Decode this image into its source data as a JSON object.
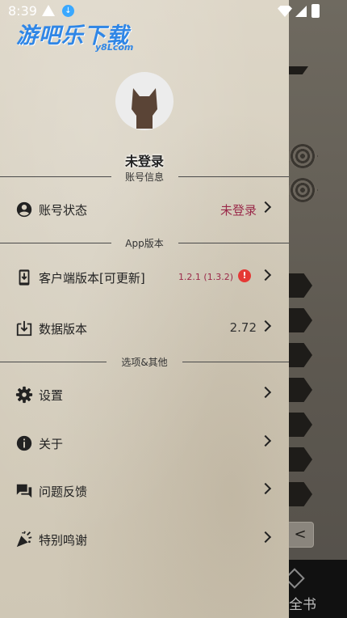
{
  "status_bar": {
    "time": "8:39"
  },
  "watermark": {
    "main": "游吧乐下载",
    "sub": "y8Lcom"
  },
  "background": {
    "bottom_label": "全书",
    "back_symbol": "<"
  },
  "drawer": {
    "username": "未登录",
    "sections": {
      "account": "账号信息",
      "app": "App版本",
      "other": "选项&其他"
    },
    "items": {
      "account_status": {
        "label": "账号状态",
        "value": "未登录",
        "icon": "account-circle-icon"
      },
      "client_version": {
        "label": "客户端版本[可更新]",
        "value": "1.2.1 (1.3.2)",
        "alert": "!",
        "icon": "phone-download-icon"
      },
      "data_version": {
        "label": "数据版本",
        "value": "2.72",
        "icon": "download-box-icon"
      },
      "settings": {
        "label": "设置",
        "icon": "gear-icon"
      },
      "about": {
        "label": "关于",
        "icon": "info-icon"
      },
      "feedback": {
        "label": "问题反馈",
        "icon": "chat-bubbles-icon"
      },
      "thanks": {
        "label": "特别鸣谢",
        "icon": "party-popper-icon"
      }
    }
  },
  "colors": {
    "accent_red": "#9a2a4a",
    "alert": "#e53935",
    "watermark_blue": "#2f86e6"
  }
}
